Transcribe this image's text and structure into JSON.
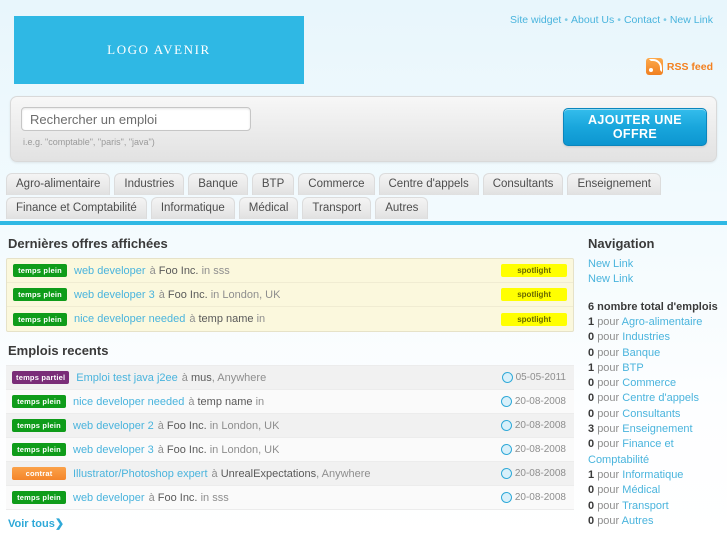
{
  "header": {
    "logo_text": "LOGO AVENIR",
    "top_links": [
      "Site widget",
      "About Us",
      "Contact",
      "New Link"
    ],
    "separator": "•",
    "rss_label": "RSS feed",
    "rss_icon": "rss-icon"
  },
  "search": {
    "placeholder": "Rechercher un emploi",
    "value": "",
    "hint": "i.e.g. \"comptable\", \"paris\", \"java\")",
    "cta_label": "AJOUTER UNE OFFRE"
  },
  "tabs": {
    "row1": [
      "Agro-alimentaire",
      "Industries",
      "Banque",
      "BTP",
      "Commerce",
      "Centre d'appels",
      "Consultants",
      "Enseignement"
    ],
    "row2": [
      "Finance et Comptabilité",
      "Informatique",
      "Médical",
      "Transport",
      "Autres"
    ]
  },
  "spotlight_section": {
    "title": "Dernières offres affichées",
    "tag_label": "spotlight",
    "jobs": [
      {
        "badge": "temps plein",
        "badge_type": "plein",
        "title": "web developer",
        "at": "à",
        "company": "Foo Inc.",
        "in": "in",
        "location": "sss"
      },
      {
        "badge": "temps plein",
        "badge_type": "plein",
        "title": "web developer 3",
        "at": "à",
        "company": "Foo Inc.",
        "in": "in",
        "location": "London, UK"
      },
      {
        "badge": "temps plein",
        "badge_type": "plein",
        "title": "nice developer needed",
        "at": "à",
        "company": "temp name",
        "in": "in",
        "location": ""
      }
    ]
  },
  "recent_section": {
    "title": "Emplois recents",
    "view_all_label": "Voir tous❯",
    "jobs": [
      {
        "badge": "temps partiel",
        "badge_type": "partiel",
        "title": "Emploi test java j2ee",
        "at": "à",
        "company": "mus",
        "in": "",
        "location": "Anywhere",
        "date": "05-05-2011"
      },
      {
        "badge": "temps plein",
        "badge_type": "plein",
        "title": "nice developer needed",
        "at": "à",
        "company": "temp name",
        "in": "in",
        "location": "",
        "date": "20-08-2008"
      },
      {
        "badge": "temps plein",
        "badge_type": "plein",
        "title": "web developer 2",
        "at": "à",
        "company": "Foo Inc.",
        "in": "in",
        "location": "London, UK",
        "date": "20-08-2008"
      },
      {
        "badge": "temps plein",
        "badge_type": "plein",
        "title": "web developer 3",
        "at": "à",
        "company": "Foo Inc.",
        "in": "in",
        "location": "London, UK",
        "date": "20-08-2008"
      },
      {
        "badge": "contrat",
        "badge_type": "contrat",
        "title": "Illustrator/Photoshop expert",
        "at": "à",
        "company": "UnrealExpectations",
        "in": "",
        "location": "Anywhere",
        "date": "20-08-2008"
      },
      {
        "badge": "temps plein",
        "badge_type": "plein",
        "title": "web developer",
        "at": "à",
        "company": "Foo Inc.",
        "in": "in",
        "location": "sss",
        "date": "20-08-2008"
      }
    ]
  },
  "sidebar": {
    "title": "Navigation",
    "links": [
      "New Link",
      "New Link"
    ],
    "total_label": "6 nombre total d'emplois",
    "pour": "pour",
    "counts": [
      {
        "count": "1",
        "category": "Agro-alimentaire"
      },
      {
        "count": "0",
        "category": "Industries"
      },
      {
        "count": "0",
        "category": "Banque"
      },
      {
        "count": "1",
        "category": "BTP"
      },
      {
        "count": "0",
        "category": "Commerce"
      },
      {
        "count": "0",
        "category": "Centre d'appels"
      },
      {
        "count": "0",
        "category": "Consultants"
      },
      {
        "count": "3",
        "category": "Enseignement"
      },
      {
        "count": "0",
        "category": "Finance et Comptabilité"
      },
      {
        "count": "1",
        "category": "Informatique"
      },
      {
        "count": "0",
        "category": "Médical"
      },
      {
        "count": "0",
        "category": "Transport"
      },
      {
        "count": "0",
        "category": "Autres"
      }
    ]
  },
  "colors": {
    "brand_cyan": "#2fb8e4",
    "link_blue": "#4ab4dd",
    "badge_green": "#0f9c1a",
    "badge_purple": "#7a2d78",
    "badge_orange": "#f4852a",
    "spotlight_yellow": "#ffff00",
    "rss_orange": "#f3801f"
  }
}
